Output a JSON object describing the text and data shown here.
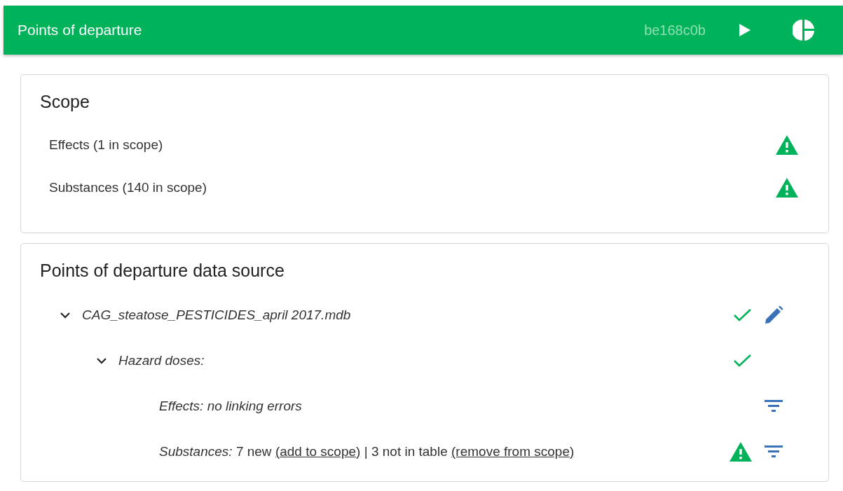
{
  "header": {
    "title": "Points of departure",
    "version": "be168c0b"
  },
  "scope": {
    "title": "Scope",
    "items": [
      {
        "label": "Effects (1 in scope)",
        "warning": true
      },
      {
        "label": "Substances (140 in scope)",
        "warning": true
      }
    ]
  },
  "data_source": {
    "title": "Points of departure data source",
    "tree": [
      {
        "label": "CAG_steatose_PESTICIDES_april 2017.mdb",
        "expanded": true,
        "ok": true,
        "editable": true,
        "children": [
          {
            "label": "Hazard doses:",
            "expanded": true,
            "ok": true,
            "editable": false,
            "children": [
              {
                "parts": [
                  {
                    "kind": "label",
                    "text": "Effects: no linking errors"
                  }
                ],
                "filterable": true
              },
              {
                "parts": [
                  {
                    "kind": "label",
                    "text": "Substances:"
                  },
                  {
                    "kind": "text",
                    "text": "7 new"
                  },
                  {
                    "kind": "link",
                    "text": "(add to scope)"
                  },
                  {
                    "kind": "text",
                    "text": "| 3 not in table"
                  },
                  {
                    "kind": "link",
                    "text": "(remove from scope)"
                  }
                ],
                "warning": true,
                "filterable": true
              }
            ]
          }
        ]
      }
    ]
  }
}
